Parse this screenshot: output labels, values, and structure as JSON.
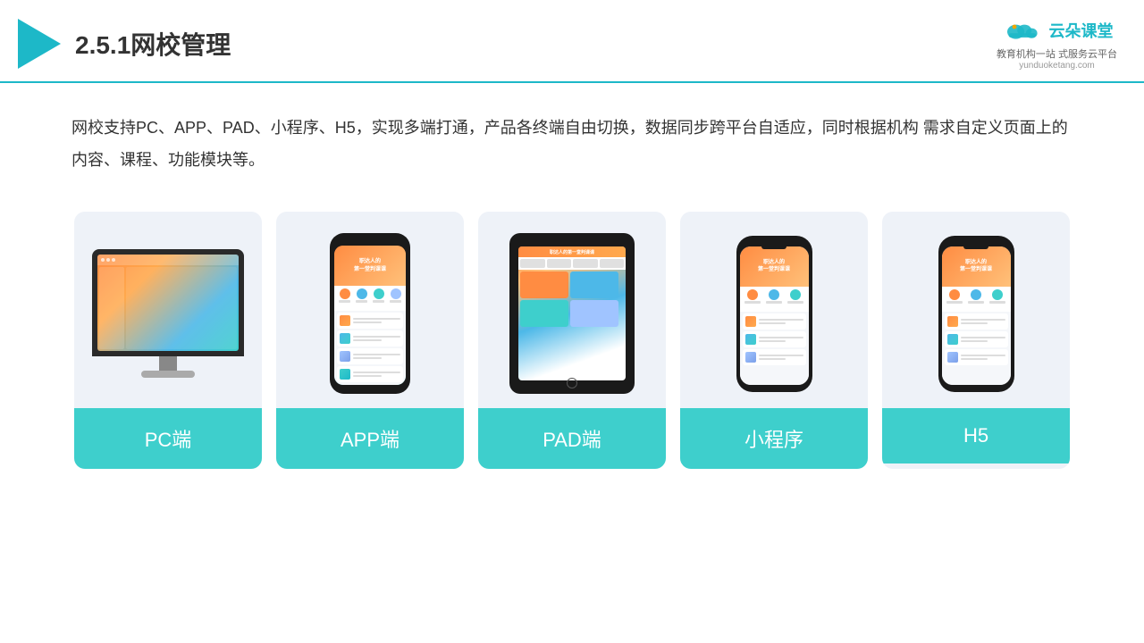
{
  "header": {
    "title": "2.5.1网校管理",
    "brand": {
      "name": "云朵课堂",
      "url": "yunduoketang.com",
      "subtitle": "教育机构一站\n式服务云平台"
    }
  },
  "description": "网校支持PC、APP、PAD、小程序、H5，实现多端打通，产品各终端自由切换，数据同步跨平台自适应，同时根据机构\n需求自定义页面上的内容、课程、功能模块等。",
  "cards": [
    {
      "id": "pc",
      "label": "PC端"
    },
    {
      "id": "app",
      "label": "APP端"
    },
    {
      "id": "pad",
      "label": "PAD端"
    },
    {
      "id": "miniprogram",
      "label": "小程序"
    },
    {
      "id": "h5",
      "label": "H5"
    }
  ],
  "colors": {
    "accent": "#1db8c8",
    "card_bg": "#eef2f8",
    "card_label_bg": "#3ecfcc"
  }
}
